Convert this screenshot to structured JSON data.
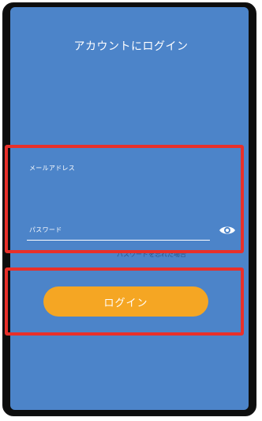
{
  "screen": {
    "title": "アカウントにログイン"
  },
  "form": {
    "email_label": "メールアドレス",
    "password_label": "パスワード",
    "partially_hidden_link": "パスワードを忘れた場合"
  },
  "actions": {
    "login_label": "ログイン"
  },
  "icons": {
    "password_toggle": "eye-icon"
  },
  "colors": {
    "background": "#4c84c9",
    "button": "#f5a623",
    "highlight": "#e8302a"
  }
}
